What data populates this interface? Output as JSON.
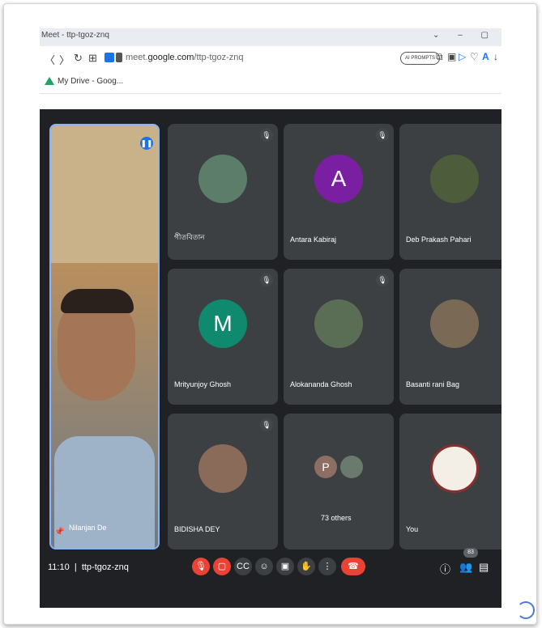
{
  "browser": {
    "tab_title": "Meet - ttp-tgoz-znq",
    "window_controls": "⌄ – ▢",
    "url_plain": "meet.",
    "url_bold": "google.com",
    "url_rest": "/ttp-tgoz-znq",
    "ai_button": "AI PROMPTS",
    "bookmark": "My Drive - Goog..."
  },
  "meeting": {
    "code": "ttp-tgoz-znq",
    "time": "11:10",
    "participant_count": "83",
    "pinned": {
      "name": "Nilanjan De"
    },
    "tiles": [
      {
        "name": "গীতবিতান",
        "kind": "photo",
        "color": "#5b7d6a"
      },
      {
        "name": "Antara Kabiraj",
        "kind": "letter",
        "letter": "A",
        "color": "#7b1fa2"
      },
      {
        "name": "Deb Prakash Pahari",
        "kind": "photo",
        "color": "#4d5c3a"
      },
      {
        "name": "Mrityunjoy Ghosh",
        "kind": "letter",
        "letter": "M",
        "color": "#0f8a6f"
      },
      {
        "name": "Alokananda Ghosh",
        "kind": "photo",
        "color": "#5a6e55"
      },
      {
        "name": "Basanti rani Bag",
        "kind": "photo",
        "color": "#7a6a55"
      },
      {
        "name": "BIDISHA DEY",
        "kind": "photo",
        "color": "#8a6b5a"
      },
      {
        "name": "73 others",
        "kind": "others",
        "letter": "P",
        "color": "#8d6e63"
      },
      {
        "name": "You",
        "kind": "logo",
        "color": "#f4efe6"
      }
    ]
  },
  "colors": {
    "meet_bg": "#202124",
    "tile_bg": "#3c4043",
    "end_call": "#ea4335",
    "active_border": "#8ab4f8"
  },
  "icons": {
    "mic": "mic-off-icon",
    "camera": "camera-off-icon",
    "captions": "captions-icon",
    "emoji": "emoji-icon",
    "present": "present-icon",
    "hand": "raise-hand-icon",
    "more": "more-options-icon",
    "hangup": "hangup-icon",
    "info": "info-icon",
    "people": "people-icon",
    "chat": "chat-icon"
  }
}
